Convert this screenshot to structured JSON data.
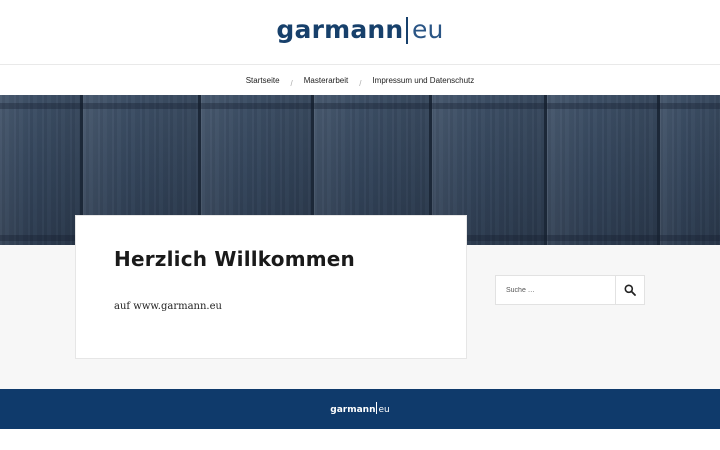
{
  "header": {
    "logo_brand": "garmann",
    "logo_tld": "eu"
  },
  "nav": {
    "items": [
      {
        "label": "Startseite"
      },
      {
        "label": "Masterarbeit"
      },
      {
        "label": "Impressum und Datenschutz"
      }
    ],
    "separator": "/"
  },
  "main": {
    "title": "Herzlich Willkommen",
    "text": "auf www.garmann.eu"
  },
  "sidebar": {
    "search": {
      "placeholder": "Suche …",
      "icon": "search-icon"
    }
  },
  "footer": {
    "logo_brand": "garmann",
    "logo_tld": "eu"
  },
  "colors": {
    "brand_blue": "#17406b",
    "footer_blue": "#0f3a6b",
    "hero_wood": "#3a4b60"
  }
}
